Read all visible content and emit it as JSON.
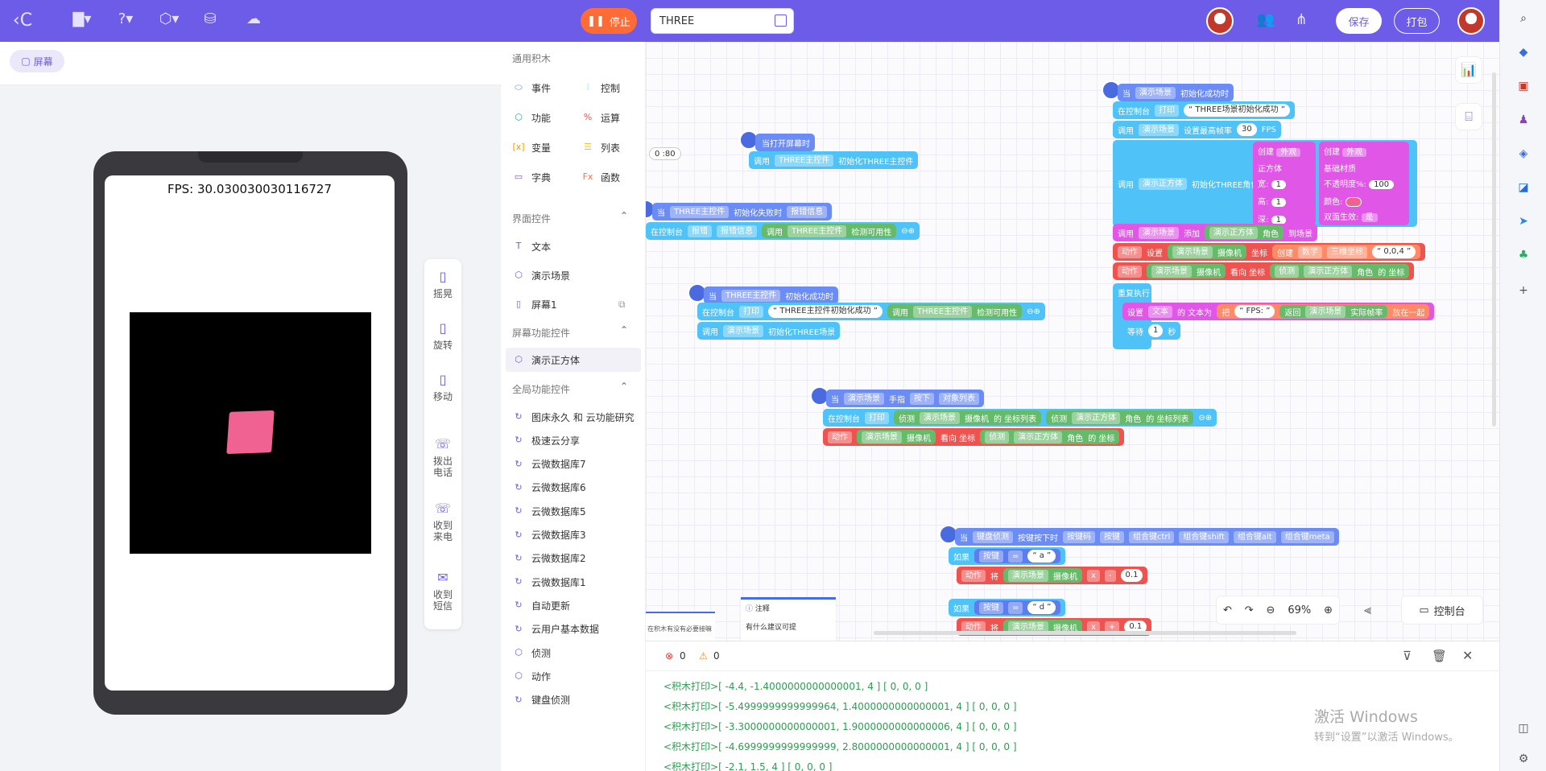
{
  "topbar": {
    "stop_label": "停止",
    "project_title": "THREE",
    "save_label": "保存",
    "pack_label": "打包"
  },
  "stage": {
    "screen_chip": "屏幕",
    "fps_text": "FPS:  30.030030030116727"
  },
  "tools": [
    {
      "label": "摇晃",
      "icon": "shake-icon"
    },
    {
      "label": "旋转",
      "icon": "rotate-icon"
    },
    {
      "label": "移动",
      "icon": "move-icon"
    },
    {
      "label": "拨出电话",
      "icon": "phone-out-icon"
    },
    {
      "label": "收到来电",
      "icon": "phone-in-icon"
    },
    {
      "label": "收到短信",
      "icon": "sms-icon"
    }
  ],
  "palette": {
    "general_title": "通用积木",
    "general": [
      {
        "label": "事件",
        "icon_color": "#5b7df0"
      },
      {
        "label": "控制",
        "icon_color": "#4fc3f7"
      },
      {
        "label": "功能",
        "icon_color": "#26a69a"
      },
      {
        "label": "运算",
        "icon_color": "#ef5350"
      },
      {
        "label": "变量",
        "icon_color": "#ff9800"
      },
      {
        "label": "列表",
        "icon_color": "#fbc02d"
      },
      {
        "label": "字典",
        "icon_color": "#7e57c2"
      },
      {
        "label": "函数",
        "icon_color": "#ff7043"
      }
    ],
    "ui_title": "界面控件",
    "ui_items": [
      "文本",
      "演示场景",
      "屏幕1"
    ],
    "screen_title": "屏幕功能控件",
    "screen_items": [
      "演示正方体"
    ],
    "global_title": "全局功能控件",
    "global_items": [
      "图床永久 和 云功能研究",
      "极速云分享",
      "云微数据库7",
      "云微数据库6",
      "云微数据库5",
      "云微数据库3",
      "云微数据库2",
      "云微数据库1",
      "自动更新",
      "云用户基本数据",
      "侦测",
      "动作",
      "键盘侦测"
    ]
  },
  "blocks": {
    "b1_hat": "当打开屏幕时",
    "b1_call": "调用",
    "b1_ctrl": "THREE主控件",
    "b1_fn": "初始化THREE主控件",
    "b2_hat_when": "当",
    "b2_hat_ctrl": "THREE主控件",
    "b2_hat_evt": "初始化失败时",
    "b2_hat_param": "报错信息",
    "b2_row": "在控制台",
    "b2_dd": "报错",
    "b2_param": "报错信息",
    "b2_call": "调用",
    "b2_ctrl": "THREE主控件",
    "b2_fn": "检测可用性",
    "b3_when": "当",
    "b3_ctrl": "THREE主控件",
    "b3_evt": "初始化成功时",
    "b3_row": "在控制台",
    "b3_dd": "打印",
    "b3_text": "“ THREE主控件初始化成功 ”",
    "b3_call": "调用",
    "b3_ctrl2": "THREE主控件",
    "b3_fn": "检测可用性",
    "b3_call2": "调用",
    "b3_scene": "演示场景",
    "b3_fn2": "初始化THREE场景",
    "b4_when": "当",
    "b4_scene": "演示场景",
    "b4_evt": "手指",
    "b4_dd": "按下",
    "b4_param": "对象列表",
    "b4_row": "在控制台",
    "b4_print": "打印",
    "b4_detect": "侦测",
    "b4_scene2": "演示场景",
    "b4_cam": "摄像机",
    "b4_list": "的 坐标列表",
    "b4_detect2": "侦测",
    "b4_cube": "演示正方体",
    "b4_role": "角色",
    "b4_list2": "的 坐标列表",
    "b4_act": "动作",
    "b4_scene3": "演示场景",
    "b4_cam2": "摄像机",
    "b4_face": "看向 坐标",
    "b4_detect3": "侦测",
    "b4_cube2": "演示正方体",
    "b4_role2": "角色",
    "b4_coord": "的 坐标",
    "b5_when": "当",
    "b5_kbd": "键盘侦测",
    "b5_evt": "按键按下时",
    "b5_p1": "按键码",
    "b5_p2": "按键",
    "b5_p3": "组合键ctrl",
    "b5_p4": "组合键shift",
    "b5_p5": "组合键alt",
    "b5_p6": "组合键meta",
    "b5_if": "如果",
    "b5_key": "按键",
    "b5_eq": "=",
    "b5_a": "“ a ”",
    "b5_act": "动作",
    "b5_set": "将",
    "b5_scene": "演示场景",
    "b5_cam": "摄像机",
    "b5_x": "x",
    "b5_minus": "-",
    "b5_val": "0.1",
    "b5_if2": "如果",
    "b5_key2": "按键",
    "b5_eq2": "=",
    "b5_d": "“ d ”",
    "b5_act2": "动作",
    "b5_set2": "将",
    "b5_scene2": "演示场景",
    "b5_cam2": "摄像机",
    "b5_x2": "x",
    "b5_plus": "+",
    "b5_val2": "0.1",
    "b6_when": "当",
    "b6_scene": "演示场景",
    "b6_evt": "初始化成功时",
    "b6_row1": "在控制台",
    "b6_print": "打印",
    "b6_text": "“ THREE场景初始化成功 ”",
    "b6_call": "调用",
    "b6_scene2": "演示场景",
    "b6_fps": "设置最高帧率",
    "b6_fpsval": "30",
    "b6_fpsunit": "FPS",
    "b6_call2": "调用",
    "b6_cube": "演示正方体",
    "b6_init": "初始化THREE角色",
    "b6_create": "创建",
    "b6_look": "外观",
    "b6_cube_lbl": "正方体",
    "b6_w": "宽:",
    "b6_w_val": "1",
    "b6_h": "高:",
    "b6_h_val": "1",
    "b6_d": "深:",
    "b6_d_val": "1",
    "b6_create2": "创建",
    "b6_look2": "外观",
    "b6_mat": "基础材质",
    "b6_opacity": "不透明度%:",
    "b6_opacity_val": "100",
    "b6_color": "颜色:",
    "b6_double": "双面生效:",
    "b6_double_val": "是",
    "b6_call3": "调用",
    "b6_scene3": "演示场景",
    "b6_add": "添加",
    "b6_cube2": "演示正方体",
    "b6_role": "角色",
    "b6_to": "到场景",
    "b6_act": "动作",
    "b6_set": "设置",
    "b6_scene4": "演示场景",
    "b6_cam": "摄像机",
    "b6_coord": "坐标",
    "b6_create3": "创建",
    "b6_num": "数学",
    "b6_vec": "三维坐标",
    "b6_vecval": "“ 0,0,4 ”",
    "b6_act2": "动作",
    "b6_scene5": "演示场景",
    "b6_cam2": "摄像机",
    "b6_face": "看向 坐标",
    "b6_detect": "侦测",
    "b6_cube3": "演示正方体",
    "b6_role2": "角色",
    "b6_coord2": "的 坐标",
    "b6_loop": "重复执行",
    "b6_set2": "设置",
    "b6_txt": "文本",
    "b6_txtfor": "的 文本为",
    "b6_join": "把",
    "b6_fpsstr": "“ FPS: ”",
    "b6_return": "返回",
    "b6_scene6": "演示场景",
    "b6_rate": "实际帧率",
    "b6_together": "放在一起",
    "b6_wait": "等待",
    "b6_wait_val": "1",
    "b6_sec": "秒",
    "stray_val": "0   :80",
    "note_title": "注释",
    "note_text": "有什么建议可提",
    "note2_text": "在积木有没有必要接嘛"
  },
  "workspace": {
    "zoom": "69%",
    "console_label": "控制台"
  },
  "console": {
    "errors": "0",
    "warnings": "0",
    "logs": [
      "<积木打印>[ -4.4, -1.4000000000000001, 4 ] [ 0, 0, 0 ]",
      "<积木打印>[ -5.4999999999999964, 1.4000000000000001, 4 ] [ 0, 0, 0 ]",
      "<积木打印>[ -3.3000000000000001, 1.9000000000000006, 4 ] [ 0, 0, 0 ]",
      "<积木打印>[ -4.6999999999999999, 2.8000000000000001, 4 ] [ 0, 0, 0 ]",
      "<积木打印>[ -2.1, 1.5, 4 ] [ 0, 0, 0 ]"
    ]
  },
  "watermark": {
    "line1": "激活 Windows",
    "line2": "转到“设置”以激活 Windows。"
  },
  "colors": {
    "accent": "#6c5ce7",
    "stop": "#ff6b35",
    "log": "#2e9d52",
    "cube": "#f06292"
  }
}
